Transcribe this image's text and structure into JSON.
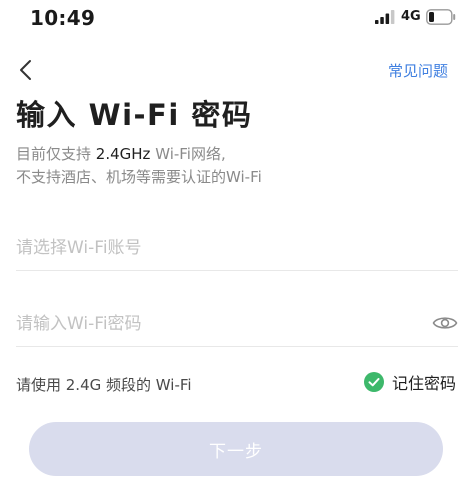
{
  "status_bar": {
    "time": "10:49",
    "network": "4G",
    "icons": [
      "signal-icon",
      "battery-icon"
    ]
  },
  "nav": {
    "back_icon": "chevron-left-icon",
    "faq_label": "常见问题"
  },
  "page": {
    "title": "输入 Wi-Fi 密码",
    "description": {
      "line1_prefix": "目前仅支持 ",
      "line1_highlight": "2.4GHz",
      "line1_suffix": " Wi-Fi网络,",
      "line2": "不支持酒店、机场等需要认证的Wi-Fi"
    }
  },
  "form": {
    "ssid": {
      "placeholder": "请选择Wi-Fi账号",
      "value": ""
    },
    "password": {
      "placeholder": "请输入Wi-Fi密码",
      "value": "",
      "visibility_icon": "eye-icon"
    },
    "band_hint": "请使用 2.4G 频段的 Wi-Fi",
    "remember": {
      "label": "记住密码",
      "checked": true,
      "icon": "check-circle-icon"
    },
    "next_label": "下一步"
  },
  "colors": {
    "accent": "#3f7fe0",
    "check_green": "#3db86b",
    "button_disabled_bg": "#d9dced",
    "muted_text": "#8a8a8a",
    "placeholder_text": "#c2c2c2"
  }
}
